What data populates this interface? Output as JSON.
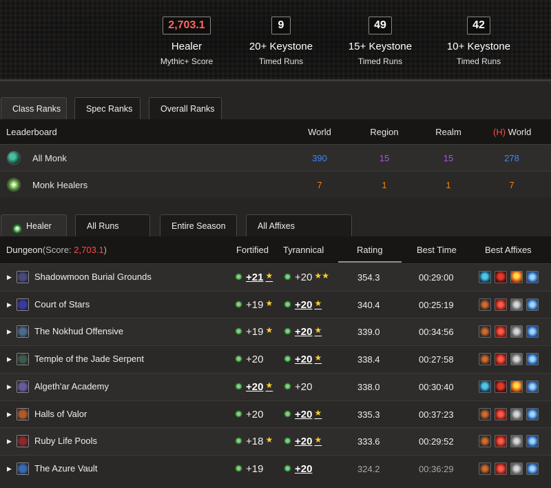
{
  "stats": [
    {
      "value": "2,703.1",
      "title": "Healer",
      "sub": "Mythic+ Score"
    },
    {
      "value": "9",
      "title": "20+ Keystone",
      "sub": "Timed Runs"
    },
    {
      "value": "49",
      "title": "15+ Keystone",
      "sub": "Timed Runs"
    },
    {
      "value": "42",
      "title": "10+ Keystone",
      "sub": "Timed Runs"
    }
  ],
  "rank_tabs": [
    "Class Ranks",
    "Spec Ranks",
    "Overall Ranks"
  ],
  "leaderboard": {
    "headers": {
      "name": "Leaderboard",
      "world": "World",
      "region": "Region",
      "realm": "Realm",
      "h_prefix": "(H)",
      "h_world": "World"
    },
    "rows": [
      {
        "name": "All Monk",
        "icon": "monk-class-icon",
        "world": "390",
        "region": "15",
        "realm": "15",
        "h_world": "278"
      },
      {
        "name": "Monk Healers",
        "icon": "healer-role-icon",
        "world": "7",
        "region": "1",
        "realm": "1",
        "h_world": "7"
      }
    ]
  },
  "run_tabs": [
    "Healer",
    "All Runs",
    "Entire Season",
    "All Affixes"
  ],
  "dungeons": {
    "headers": {
      "dungeon": "Dungeon",
      "score_prefix": "(Score: ",
      "score": "2,703.1",
      "score_suffix": ")",
      "fortified": "Fortified",
      "tyrannical": "Tyrannical",
      "rating": "Rating",
      "best_time": "Best Time",
      "best_affixes": "Best Affixes"
    },
    "rows": [
      {
        "name": "Shadowmoon Burial Grounds",
        "fort": "+21",
        "fort_stars": "★",
        "tyr": "+20",
        "tyr_stars": "★★",
        "best": "fort",
        "rating": "354.3",
        "time": "00:29:00",
        "affixes": [
          "af-fort",
          "af-spite",
          "af-storm",
          "af-thund"
        ]
      },
      {
        "name": "Court of Stars",
        "fort": "+19",
        "fort_stars": "★",
        "tyr": "+20",
        "tyr_stars": "★",
        "best": "tyr",
        "rating": "340.4",
        "time": "00:25:19",
        "affixes": [
          "af-tyran",
          "af-red",
          "af-rock",
          "af-thund"
        ]
      },
      {
        "name": "The Nokhud Offensive",
        "fort": "+19",
        "fort_stars": "★",
        "tyr": "+20",
        "tyr_stars": "★",
        "best": "tyr",
        "rating": "339.0",
        "time": "00:34:56",
        "affixes": [
          "af-tyran",
          "af-red",
          "af-rock",
          "af-thund"
        ]
      },
      {
        "name": "Temple of the Jade Serpent",
        "fort": "+20",
        "fort_stars": "",
        "tyr": "+20",
        "tyr_stars": "★",
        "best": "tyr",
        "rating": "338.4",
        "time": "00:27:58",
        "affixes": [
          "af-tyran",
          "af-red",
          "af-rock",
          "af-thund"
        ]
      },
      {
        "name": "Algeth'ar Academy",
        "fort": "+20",
        "fort_stars": "★",
        "tyr": "+20",
        "tyr_stars": "",
        "best": "fort",
        "rating": "338.0",
        "time": "00:30:40",
        "affixes": [
          "af-fort",
          "af-spite",
          "af-storm",
          "af-thund"
        ]
      },
      {
        "name": "Halls of Valor",
        "fort": "+20",
        "fort_stars": "",
        "tyr": "+20",
        "tyr_stars": "★",
        "best": "tyr",
        "rating": "335.3",
        "time": "00:37:23",
        "affixes": [
          "af-tyran",
          "af-red",
          "af-rock",
          "af-thund"
        ]
      },
      {
        "name": "Ruby Life Pools",
        "fort": "+18",
        "fort_stars": "★",
        "tyr": "+20",
        "tyr_stars": "★",
        "best": "tyr",
        "rating": "333.6",
        "time": "00:29:52",
        "affixes": [
          "af-tyran",
          "af-red",
          "af-rock",
          "af-thund"
        ]
      },
      {
        "name": "The Azure Vault",
        "fort": "+19",
        "fort_stars": "",
        "tyr": "+20",
        "tyr_stars": "",
        "best": "tyr",
        "rating": "324.2",
        "time": "00:36:29",
        "dim": true,
        "affixes": [
          "af-tyran",
          "af-red",
          "af-rock",
          "af-thund"
        ]
      }
    ]
  },
  "colors": {
    "score": "#ff6464",
    "world": "#3a87ff",
    "region": "#b04cf0",
    "realm": "#b04cf0",
    "hworld": "#3a87ff",
    "legendary": "#ff8000",
    "horde": "#ff4a4a"
  }
}
